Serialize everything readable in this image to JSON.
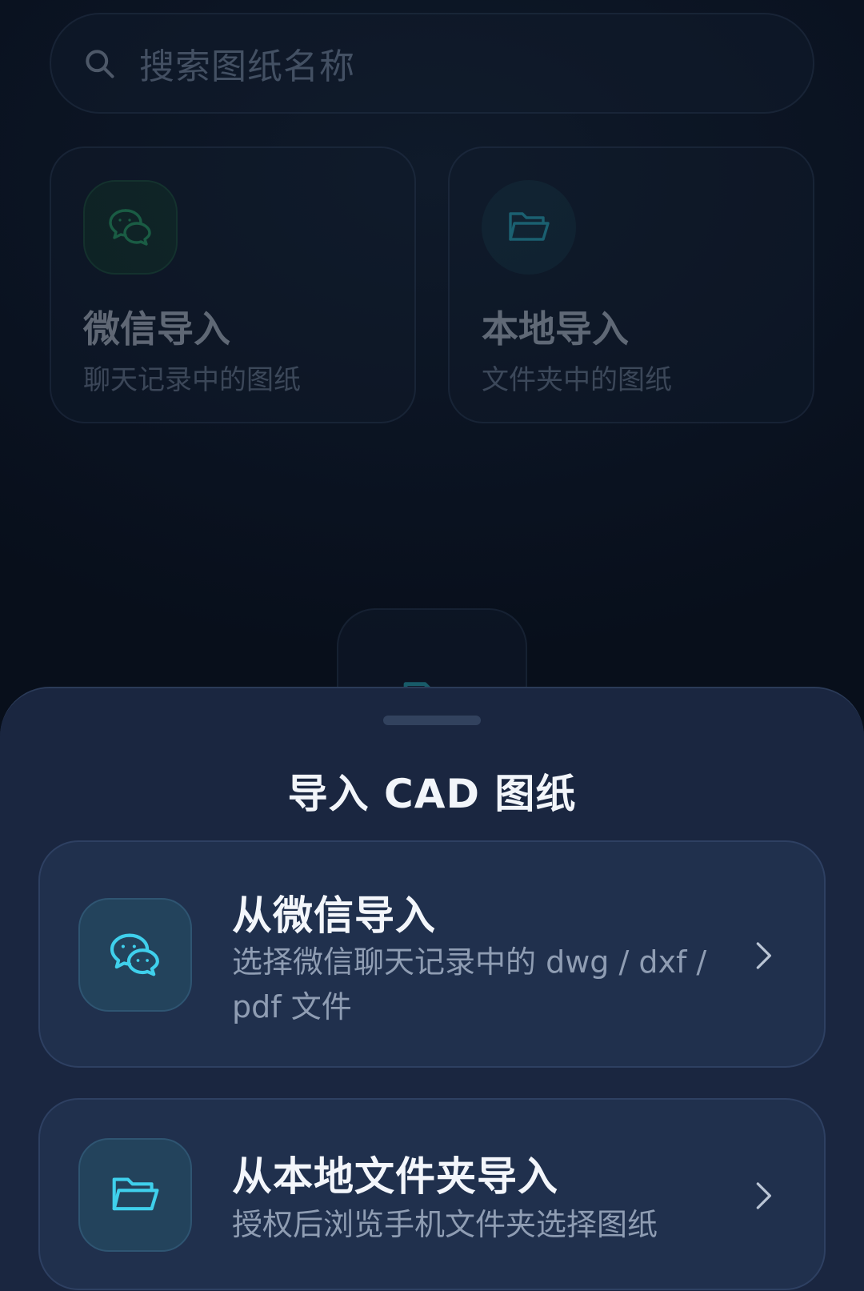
{
  "background": {
    "search": {
      "placeholder": "搜索图纸名称",
      "icon": "search-icon"
    },
    "cards": [
      {
        "title": "微信导入",
        "subtitle": "聊天记录中的图纸",
        "icon": "wechat-icon",
        "accent": "#2fbf71"
      },
      {
        "title": "本地导入",
        "subtitle": "文件夹中的图纸",
        "icon": "folder-icon",
        "accent": "#2ec4d6"
      }
    ],
    "center_icon": "folder-icon"
  },
  "sheet": {
    "title": "导入 CAD 图纸",
    "options": [
      {
        "title": "从微信导入",
        "description": "选择微信聊天记录中的 dwg / dxf / pdf 文件",
        "icon": "wechat-icon",
        "action_icon": "chevron-right-icon"
      },
      {
        "title": "从本地文件夹导入",
        "description": "授权后浏览手机文件夹选择图纸",
        "icon": "folder-icon",
        "action_icon": "chevron-right-icon"
      }
    ]
  },
  "colors": {
    "accent_cyan": "#3fd0ec",
    "sheet_bg": "#1a2640",
    "option_bg": "#20304d",
    "page_bg": "#0a1220"
  }
}
